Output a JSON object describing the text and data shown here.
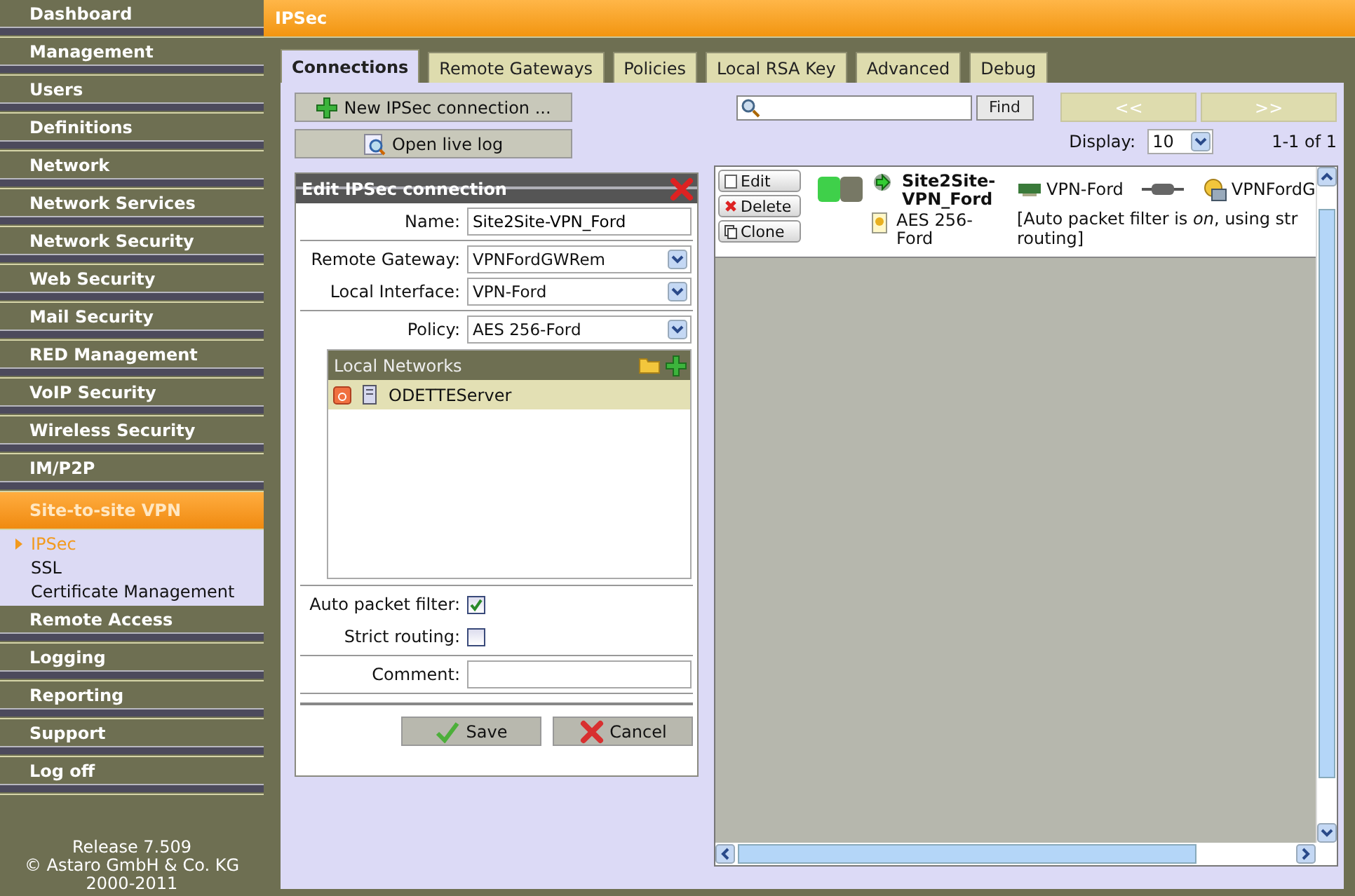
{
  "sidebar": {
    "items": [
      {
        "label": "Dashboard",
        "selected": false
      },
      {
        "label": "Management",
        "selected": false
      },
      {
        "label": "Users",
        "selected": false
      },
      {
        "label": "Definitions",
        "selected": false
      },
      {
        "label": "Network",
        "selected": false
      },
      {
        "label": "Network Services",
        "selected": false
      },
      {
        "label": "Network Security",
        "selected": false
      },
      {
        "label": "Web Security",
        "selected": false
      },
      {
        "label": "Mail Security",
        "selected": false
      },
      {
        "label": "RED Management",
        "selected": false
      },
      {
        "label": "VoIP Security",
        "selected": false
      },
      {
        "label": "Wireless Security",
        "selected": false
      },
      {
        "label": "IM/P2P",
        "selected": false
      },
      {
        "label": "Site-to-site VPN",
        "selected": true,
        "expanded": true,
        "children": [
          {
            "label": "IPSec",
            "selected": true
          },
          {
            "label": "SSL",
            "selected": false
          },
          {
            "label": "Certificate Management",
            "selected": false
          }
        ]
      },
      {
        "label": "Remote Access",
        "selected": false
      },
      {
        "label": "Logging",
        "selected": false
      },
      {
        "label": "Reporting",
        "selected": false
      },
      {
        "label": "Support",
        "selected": false
      },
      {
        "label": "Log off",
        "selected": false
      }
    ],
    "footer": [
      "Release 7.509",
      "© Astaro GmbH & Co. KG",
      "2000-2011"
    ]
  },
  "header": {
    "title": "IPSec"
  },
  "tabs": [
    {
      "label": "Connections",
      "selected": true
    },
    {
      "label": "Remote Gateways",
      "selected": false
    },
    {
      "label": "Policies",
      "selected": false
    },
    {
      "label": "Local RSA Key",
      "selected": false
    },
    {
      "label": "Advanced",
      "selected": false
    },
    {
      "label": "Debug",
      "selected": false
    }
  ],
  "actions": [
    {
      "label": "New IPSec connection ...",
      "kind": "add"
    },
    {
      "label": "Open live log",
      "kind": "log"
    }
  ],
  "search": {
    "button": "Find"
  },
  "pager": {
    "prev": "<<",
    "next": ">>",
    "disabled": true
  },
  "display": {
    "label": "Display:",
    "value": "10"
  },
  "count": "1-1 of 1",
  "edit_form": {
    "title": "Edit IPSec connection",
    "groups": [
      [
        {
          "kind": "text",
          "label": "Name:",
          "value": "Site2Site-VPN_Ford"
        }
      ],
      [
        {
          "kind": "select",
          "label": "Remote Gateway:",
          "value": "VPNFordGWRem"
        },
        {
          "kind": "select",
          "label": "Local Interface:",
          "value": "VPN-Ford"
        }
      ],
      [
        {
          "kind": "select",
          "label": "Policy:",
          "value": "AES 256-Ford"
        },
        {
          "kind": "list",
          "title": "Local Networks",
          "items": [
            {
              "label": "ODETTEServer",
              "selected": true
            }
          ]
        }
      ],
      [
        {
          "kind": "checkbox",
          "label": "Auto packet filter:",
          "checked": true
        },
        {
          "kind": "checkbox",
          "label": "Strict routing:",
          "checked": false
        }
      ],
      [
        {
          "kind": "text",
          "label": "Comment:"
        }
      ]
    ],
    "buttons": [
      {
        "label": "Save",
        "kind": "save"
      },
      {
        "label": "Cancel",
        "kind": "cancel"
      }
    ]
  },
  "connections": [
    {
      "buttons": [
        {
          "label": "Edit",
          "kind": "edit"
        },
        {
          "label": "Delete",
          "kind": "delete"
        },
        {
          "label": "Clone",
          "kind": "clone"
        }
      ],
      "on": true,
      "name": "Site2Site-VPN_Ford",
      "policy": "AES 256-Ford",
      "interface": "VPN-Ford",
      "gateway": "VPNFordG",
      "description": [
        "[Auto packet filter is *on*, using str",
        "routing]"
      ]
    }
  ]
}
